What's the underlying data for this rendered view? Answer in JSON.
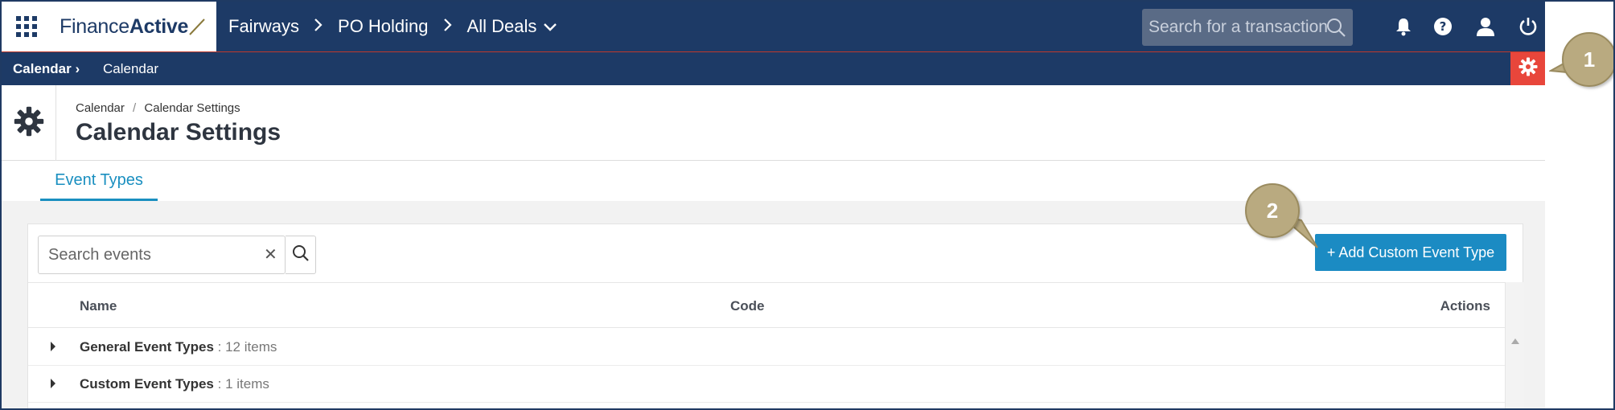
{
  "topbar": {
    "logo_light": "Finance",
    "logo_bold": "Active",
    "breadcrumbs": [
      "Fairways",
      "PO Holding",
      "All Deals"
    ],
    "search_placeholder": "Search for a transaction"
  },
  "subbar": {
    "crumb1": "Calendar",
    "crumb2": "Calendar"
  },
  "header": {
    "breadcrumb_parent": "Calendar",
    "breadcrumb_sep": "/",
    "breadcrumb_current": "Calendar Settings",
    "title": "Calendar Settings"
  },
  "tabs": [
    {
      "label": "Event Types",
      "active": true
    }
  ],
  "toolbar": {
    "search_placeholder": "Search events",
    "add_label": "+ Add Custom Event Type"
  },
  "table": {
    "columns": [
      "Name",
      "Code",
      "Actions"
    ],
    "rows": [
      {
        "name": "General Event Types",
        "count": ": 12 items"
      },
      {
        "name": "Custom Event Types",
        "count": ": 1 items"
      }
    ]
  },
  "callouts": [
    "1",
    "2"
  ],
  "colors": {
    "navy": "#1d3a66",
    "accent_blue": "#1b8bc3",
    "settings_red": "#e8463b",
    "callout_tan": "#b9aa80"
  },
  "icons": [
    "apps-grid-icon",
    "search-icon",
    "bell-icon",
    "help-icon",
    "user-icon",
    "power-icon",
    "gear-icon",
    "clear-icon",
    "chevron-down-icon",
    "caret-right-icon"
  ]
}
